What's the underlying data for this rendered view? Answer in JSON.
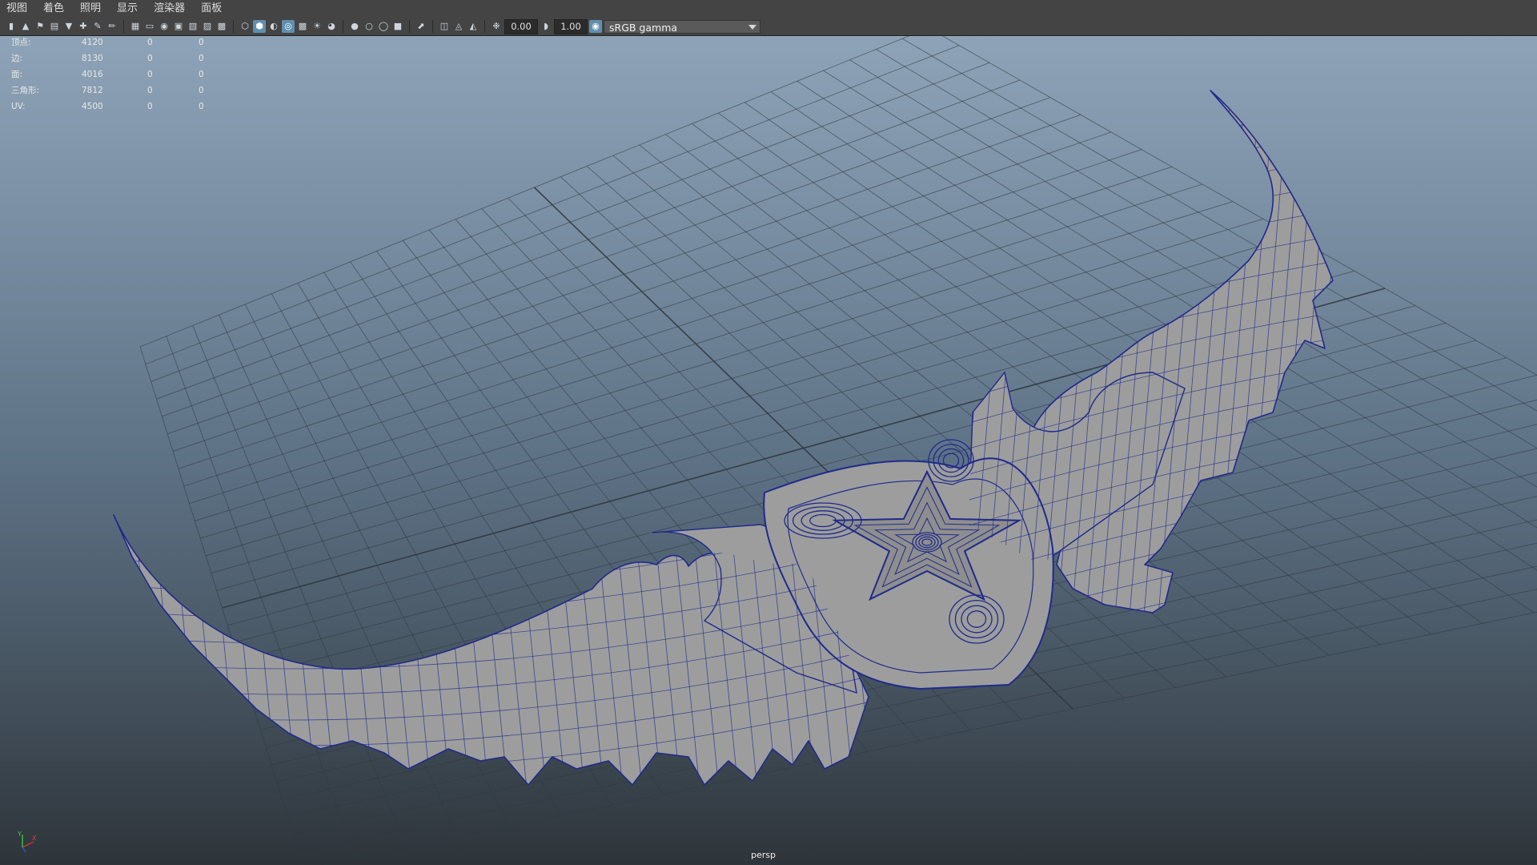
{
  "menubar": {
    "items": [
      "视图",
      "着色",
      "照明",
      "显示",
      "渲染器",
      "面板"
    ]
  },
  "toolbar": {
    "exposure_value": "0.00",
    "gamma_value": "1.00",
    "color_space": "sRGB gamma"
  },
  "hud": {
    "rows": [
      {
        "label": "顶点:",
        "v1": "4120",
        "v2": "0",
        "v3": "0"
      },
      {
        "label": "边:",
        "v1": "8130",
        "v2": "0",
        "v3": "0"
      },
      {
        "label": "面:",
        "v1": "4016",
        "v2": "0",
        "v3": "0"
      },
      {
        "label": "三角形:",
        "v1": "7812",
        "v2": "0",
        "v3": "0"
      },
      {
        "label": "UV:",
        "v1": "4500",
        "v2": "0",
        "v3": "0"
      }
    ]
  },
  "viewport": {
    "camera": "persp",
    "axis_labels": {
      "x": "X",
      "y": "Y",
      "z": "Z"
    },
    "wire_color": "#1f2a8c",
    "mesh_color": "#9d9d9d",
    "grid_color": "#2f3942"
  }
}
